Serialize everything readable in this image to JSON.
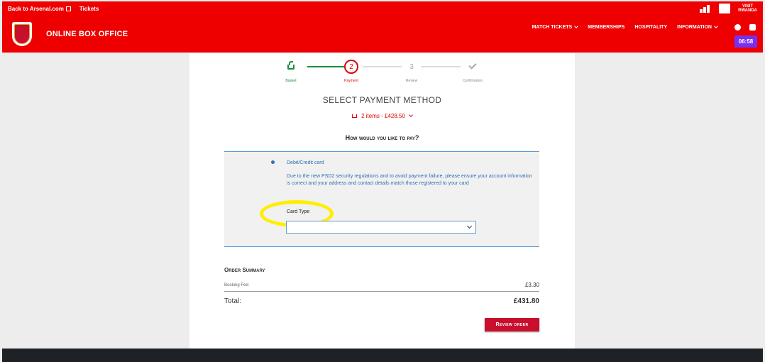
{
  "topbar": {
    "back_link": "Back to Arsenal.com",
    "tickets_link": "Tickets",
    "visit_line1": "VISIT",
    "visit_line2": "RWANDA"
  },
  "header": {
    "brand": "ONLINE BOX OFFICE",
    "nav": [
      "MATCH TICKETS",
      "MEMBERSHIPS",
      "HOSPITALITY",
      "INFORMATION"
    ],
    "timer": "06:58",
    "colors": {
      "primary": "#ee0000",
      "timer": "#7a2ff0"
    }
  },
  "steps": [
    {
      "label": "Basket",
      "marker": "",
      "state": "done"
    },
    {
      "label": "Payment",
      "marker": "2",
      "state": "active"
    },
    {
      "label": "Review",
      "marker": "3",
      "state": "todo"
    },
    {
      "label": "Confirmation",
      "marker": "",
      "state": "todo"
    }
  ],
  "page": {
    "title": "SELECT PAYMENT METHOD",
    "summary_toggle": "2 items - £428.50",
    "question": "How would you like to pay?"
  },
  "payment": {
    "option_label": "Debit/Credit card",
    "notice": "Due to the new PSD2 security regulations and to avoid payment failure, please ensure your account information is correct and your address and contact details match those registered to your card",
    "card_type_label": "Card Type",
    "card_type_value": ""
  },
  "order": {
    "title": "Order Summary",
    "booking_fee_label": "Booking Fee:",
    "booking_fee_value": "£3.30",
    "total_label": "Total:",
    "total_value": "£431.80",
    "review_button": "Review order"
  }
}
